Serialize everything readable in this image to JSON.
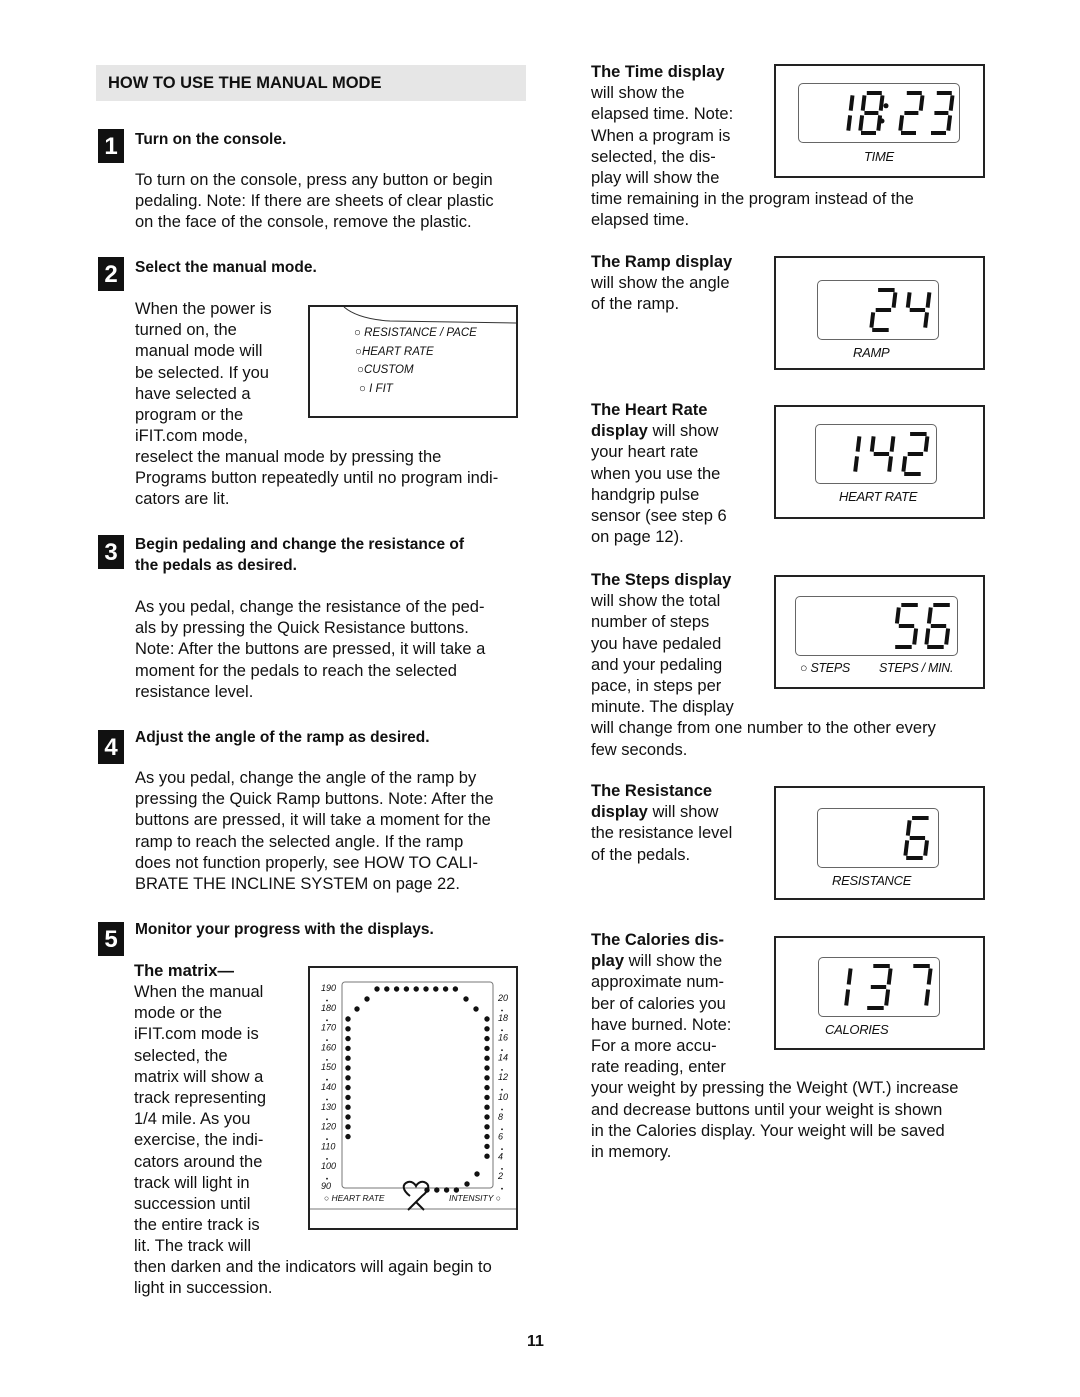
{
  "section": {
    "title": "HOW TO USE THE MANUAL MODE"
  },
  "steps": [
    {
      "number": "1",
      "title": "Turn on the console.",
      "body": [
        "To turn on the console, press any button or begin",
        "pedaling. Note: If there are sheets of clear plastic",
        "on the face of the console, remove the plastic."
      ]
    },
    {
      "number": "2",
      "title": "Select the manual mode.",
      "body_narrow": [
        "When the power is",
        "turned on, the",
        "manual mode will",
        "be selected. If you",
        "have selected a",
        "program or the",
        "iFIT.com mode,"
      ],
      "body_wide": [
        "reselect the manual mode by pressing the",
        "Programs button repeatedly until no program indi-",
        "cators are lit."
      ]
    },
    {
      "number": "3",
      "title_lines": [
        "Begin pedaling and change the resistance of",
        "the pedals as desired."
      ],
      "body": [
        "As you pedal, change the resistance of the ped-",
        "als by pressing the Quick Resistance buttons.",
        "Note: After the buttons are pressed, it will take a",
        "moment for the pedals to reach the selected",
        "resistance level."
      ]
    },
    {
      "number": "4",
      "title": "Adjust the angle of the ramp as desired.",
      "body": [
        "As you pedal, change the angle of the ramp by",
        "pressing the Quick Ramp buttons. Note: After the",
        "buttons are pressed, it will take a moment for the",
        "ramp to reach the selected angle. If the ramp",
        "does not function properly, see HOW TO CALI-",
        "BRATE THE INCLINE SYSTEM on page 22."
      ]
    },
    {
      "number": "5",
      "title": "Monitor your progress with the displays.",
      "subhead": "The matrix—",
      "body_narrow": [
        "When the manual",
        "mode or the",
        "iFIT.com mode is",
        "selected, the",
        "matrix will show a",
        "track representing",
        "1/4 mile. As you",
        "exercise, the indi-",
        "cators around the",
        "track will light in",
        "succession until",
        "the entire track is",
        "lit. The track will"
      ],
      "body_wide": [
        "then darken and the indicators will again begin to",
        "light in succession."
      ]
    }
  ],
  "program_panel": {
    "indicators": [
      "RESISTANCE / PACE",
      "HEART RATE",
      "CUSTOM",
      "I FIT"
    ]
  },
  "matrix": {
    "left_scale": [
      "190",
      "180",
      "170",
      "160",
      "150",
      "140",
      "130",
      "120",
      "110",
      "100",
      "90"
    ],
    "right_scale": [
      "20",
      "18",
      "16",
      "14",
      "12",
      "10",
      "8",
      "6",
      "4",
      "2"
    ],
    "heart_rate_label": "HEART RATE",
    "intensity_label": "INTENSITY"
  },
  "displays": [
    {
      "id": "time",
      "bold": "The Time display",
      "lines_narrow": [
        "will show the",
        "elapsed time. Note:",
        "When a program is",
        "selected, the dis-",
        "play will show the"
      ],
      "lines_wide": [
        "time remaining in the program instead of the",
        "elapsed time."
      ],
      "value": "18:23",
      "label": "TIME"
    },
    {
      "id": "ramp",
      "bold": "The Ramp display",
      "lines_narrow": [
        "will show the angle",
        "of the ramp."
      ],
      "lines_wide": [],
      "value": "24",
      "label": "RAMP"
    },
    {
      "id": "heart",
      "bold": "The Heart Rate",
      "bold2": "display",
      "rest2": " will show",
      "lines_narrow": [
        "your heart rate",
        "when you use the",
        "handgrip pulse",
        "sensor (see step 6",
        "on page 12)."
      ],
      "lines_wide": [],
      "value": "142",
      "label": "HEART RATE"
    },
    {
      "id": "steps",
      "bold": "The Steps display",
      "lines_narrow": [
        "will show the total",
        "number of steps",
        "you have pedaled",
        "and your pedaling",
        "pace, in steps per",
        "minute. The display"
      ],
      "lines_wide": [
        "will change from one number to the other every",
        "few seconds."
      ],
      "value": "56",
      "label_left": "STEPS",
      "label_right": "STEPS / MIN."
    },
    {
      "id": "resistance",
      "bold": "The Resistance",
      "bold2": "display",
      "rest2": " will show",
      "lines_narrow": [
        "the resistance level",
        "of the pedals."
      ],
      "lines_wide": [],
      "value": "6",
      "label": "RESISTANCE"
    },
    {
      "id": "calories",
      "bold": "The Calories dis-",
      "bold2": "play",
      "rest2": " will show the",
      "lines_narrow": [
        "approximate num-",
        "ber of calories you",
        "have burned. Note:",
        "For a more accu-",
        "rate reading, enter"
      ],
      "lines_wide": [
        "your weight by pressing the Weight (WT.) increase",
        "and decrease buttons until your weight is shown",
        "in the Calories display. Your weight will be saved",
        "in memory."
      ],
      "value": "137",
      "label": "CALORIES"
    }
  ],
  "page_number": "11"
}
